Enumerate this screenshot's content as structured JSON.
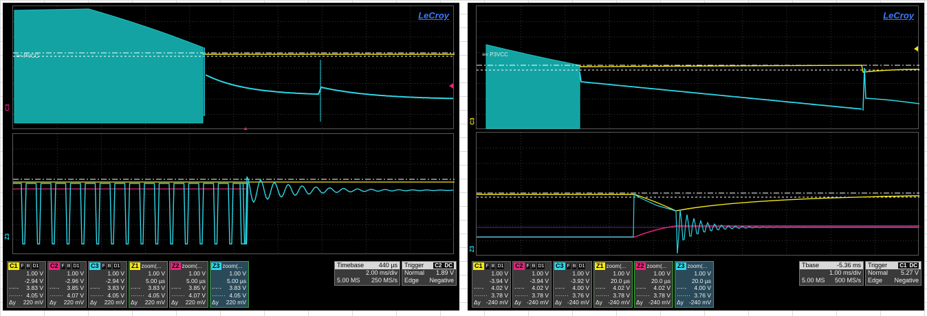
{
  "brand": "LeCroy",
  "left": {
    "ref_label": "≡≈ PVCC",
    "top_tag": "C3",
    "bottom_tag": "Z3",
    "descriptors": [
      {
        "id": "C1",
        "kind": "channel",
        "color": "#f2e61c",
        "flags": [
          "F",
          "B",
          "D1"
        ],
        "rows": [
          [
            "",
            "1.00 V"
          ],
          [
            "",
            "-2.94 V"
          ],
          [
            "",
            "3.83 V"
          ],
          [
            "",
            "4.05 V"
          ],
          [
            "Δy",
            "220 mV"
          ]
        ]
      },
      {
        "id": "C2",
        "kind": "channel",
        "color": "#e8247a",
        "flags": [
          "F",
          "B",
          "D1"
        ],
        "rows": [
          [
            "",
            "1.00 V"
          ],
          [
            "",
            "-2.96 V"
          ],
          [
            "",
            "3.85 V"
          ],
          [
            "",
            "4.07 V"
          ],
          [
            "Δy",
            "220 mV"
          ]
        ]
      },
      {
        "id": "C3",
        "kind": "channel",
        "color": "#2ed8e8",
        "flags": [
          "F",
          "B",
          "D1"
        ],
        "rows": [
          [
            "",
            "1.00 V"
          ],
          [
            "",
            "-2.94 V"
          ],
          [
            "",
            "3.83 V"
          ],
          [
            "",
            "4.05 V"
          ],
          [
            "Δy",
            "220 mV"
          ]
        ]
      },
      {
        "id": "Z1",
        "kind": "zoom",
        "color": "#f2e61c",
        "title": "zoom(...",
        "rows": [
          [
            "",
            "1.00 V"
          ],
          [
            "",
            "5.00 µs"
          ],
          [
            "",
            "3.83 V"
          ],
          [
            "",
            "4.05 V"
          ],
          [
            "Δy",
            "220 mV"
          ]
        ]
      },
      {
        "id": "Z2",
        "kind": "zoom",
        "color": "#e8247a",
        "title": "zoom(...",
        "rows": [
          [
            "",
            "1.00 V"
          ],
          [
            "",
            "5.00 µs"
          ],
          [
            "",
            "3.85 V"
          ],
          [
            "",
            "4.07 V"
          ],
          [
            "Δy",
            "220 mV"
          ]
        ]
      },
      {
        "id": "Z3",
        "kind": "zoom",
        "color": "#2ed8e8",
        "title": "zoom(...",
        "active": true,
        "rows": [
          [
            "",
            "1.00 V"
          ],
          [
            "",
            "5.00 µs"
          ],
          [
            "",
            "3.83 V"
          ],
          [
            "",
            "4.05 V"
          ],
          [
            "Δy",
            "220 mV"
          ]
        ]
      }
    ],
    "timebase": {
      "label": "Timebase",
      "delay": "440 µs",
      "per_div": "2.00 ms/div",
      "memory": "5.00 MS",
      "rate": "250 MS/s"
    },
    "trigger": {
      "label": "Trigger",
      "source": "C2",
      "coupling": "DC",
      "mode": "Normal",
      "level": "1.89 V",
      "type": "Edge",
      "slope": "Negative"
    }
  },
  "right": {
    "ref_label": "≡≈ P3VCC",
    "top_tag": "C3",
    "bottom_tag": "Z3",
    "descriptors": [
      {
        "id": "C1",
        "kind": "channel",
        "color": "#f2e61c",
        "flags": [
          "F",
          "B",
          "D1"
        ],
        "rows": [
          [
            "",
            "1.00 V"
          ],
          [
            "",
            "-3.94 V"
          ],
          [
            "",
            "4.02 V"
          ],
          [
            "",
            "3.78 V"
          ],
          [
            "Δy",
            "-240 mV"
          ]
        ]
      },
      {
        "id": "C2",
        "kind": "channel",
        "color": "#e8247a",
        "flags": [
          "F",
          "B",
          "D1"
        ],
        "rows": [
          [
            "",
            "1.00 V"
          ],
          [
            "",
            "-3.94 V"
          ],
          [
            "",
            "4.02 V"
          ],
          [
            "",
            "3.78 V"
          ],
          [
            "Δy",
            "-240 mV"
          ]
        ]
      },
      {
        "id": "C3",
        "kind": "channel",
        "color": "#2ed8e8",
        "flags": [
          "F",
          "B",
          "D1"
        ],
        "rows": [
          [
            "",
            "1.00 V"
          ],
          [
            "",
            "-3.92 V"
          ],
          [
            "",
            "4.00 V"
          ],
          [
            "",
            "3.76 V"
          ],
          [
            "Δy",
            "-240 mV"
          ]
        ]
      },
      {
        "id": "Z1",
        "kind": "zoom",
        "color": "#f2e61c",
        "title": "zoom(...",
        "rows": [
          [
            "",
            "1.00 V"
          ],
          [
            "",
            "20.0 µs"
          ],
          [
            "",
            "4.02 V"
          ],
          [
            "",
            "3.78 V"
          ],
          [
            "Δy",
            "-240 mV"
          ]
        ]
      },
      {
        "id": "Z2",
        "kind": "zoom",
        "color": "#e8247a",
        "title": "zoom(...",
        "rows": [
          [
            "",
            "1.00 V"
          ],
          [
            "",
            "20.0 µs"
          ],
          [
            "",
            "4.02 V"
          ],
          [
            "",
            "3.78 V"
          ],
          [
            "Δy",
            "-240 mV"
          ]
        ]
      },
      {
        "id": "Z3",
        "kind": "zoom",
        "color": "#2ed8e8",
        "title": "zoom(...",
        "active": true,
        "rows": [
          [
            "",
            "1.00 V"
          ],
          [
            "",
            "20.0 µs"
          ],
          [
            "",
            "4.00 V"
          ],
          [
            "",
            "3.76 V"
          ],
          [
            "Δy",
            "-240 mV"
          ]
        ]
      }
    ],
    "timebase": {
      "label": "Tbase",
      "delay": "-5.36 ms",
      "per_div": "1.00 ms/div",
      "memory": "5.00 MS",
      "rate": "500 MS/s"
    },
    "trigger": {
      "label": "Trigger",
      "source": "C1",
      "coupling": "DC",
      "mode": "Normal",
      "level": "5.27 V",
      "type": "Edge",
      "slope": "Negative"
    }
  }
}
